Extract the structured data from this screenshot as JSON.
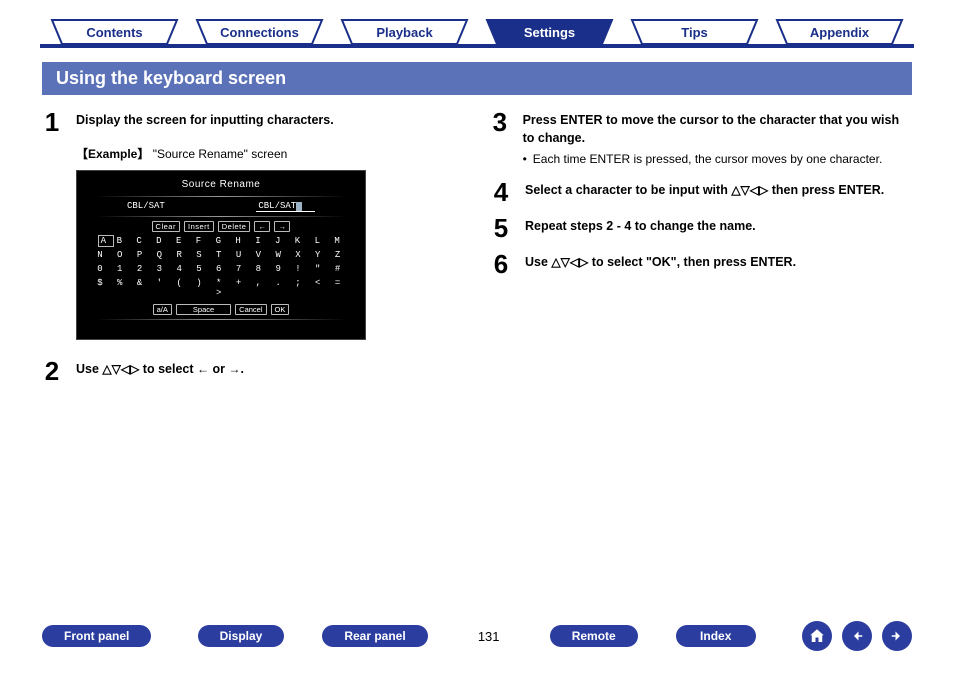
{
  "tabs": {
    "contents": "Contents",
    "connections": "Connections",
    "playback": "Playback",
    "settings": "Settings",
    "tips": "Tips",
    "appendix": "Appendix"
  },
  "section_title": "Using the keyboard screen",
  "steps": {
    "s1": {
      "num": "1",
      "text": "Display the screen for inputting characters.",
      "example_prefix": "【Example】",
      "example_text": " \"Source Rename\" screen"
    },
    "s2": {
      "num": "2",
      "text_a": "Use ",
      "text_b": " to select ",
      "text_c": " or ",
      "text_d": "."
    },
    "s3": {
      "num": "3",
      "text": "Press ENTER to move the cursor to the character that you wish to change.",
      "bullet": "Each time ENTER is pressed, the cursor moves by one character."
    },
    "s4": {
      "num": "4",
      "text_a": "Select a character to be input with ",
      "text_b": " then press ENTER."
    },
    "s5": {
      "num": "5",
      "text": "Repeat steps 2 - 4 to change the name."
    },
    "s6": {
      "num": "6",
      "text_a": "Use ",
      "text_b": " to select \"OK\", then press ENTER."
    }
  },
  "keyboard": {
    "title": "Source Rename",
    "left_label": "CBL/SAT",
    "right_label": "CBL/SAT",
    "row_buttons": {
      "clear": "Clear",
      "insert": "Insert",
      "delete": "Delete",
      "left": "←",
      "right": "→"
    },
    "row_alpha1": "A B C D E F G H I J K L M",
    "row_alpha1_boxed": "A",
    "row_alpha2": "N O P Q R S T U V W X Y Z",
    "row_num": "0 1 2 3 4 5 6 7 8 9 ! \" #",
    "row_sym": "$ % & ' ( ) * + , . ; < = >",
    "row_bottom": {
      "aA": "a/A",
      "space": "Space",
      "cancel": "Cancel",
      "ok": "OK"
    }
  },
  "bottom": {
    "front_panel": "Front panel",
    "display": "Display",
    "rear_panel": "Rear panel",
    "remote": "Remote",
    "index": "Index",
    "page": "131"
  },
  "glyphs": {
    "udlr": "△▽◁▷",
    "larr": "←",
    "rarr": "→"
  }
}
